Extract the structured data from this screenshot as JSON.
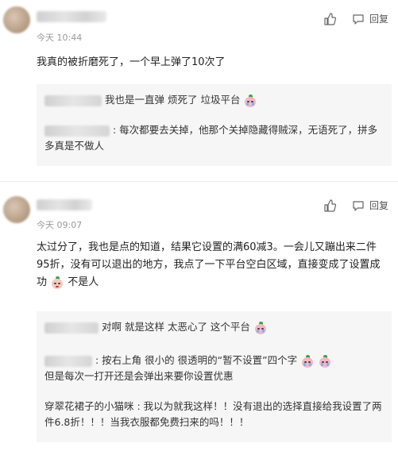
{
  "comments": [
    {
      "time": "今天 10:44",
      "like_label": "",
      "reply_label": "回复",
      "text": "我真的被折磨死了，一个早上弹了10次了",
      "replies": [
        {
          "text": "我也是一直弹 烦死了 垃圾平台"
        },
        {
          "text": ": 每次都要去关掉，他那个关掉隐藏得贼深，无语死了，拼多多真是不做人"
        }
      ]
    },
    {
      "time": "今天 09:07",
      "like_label": "",
      "reply_label": "回复",
      "text_a": "太过分了，我也是点的知道，结果它设置的满60减3。一会儿又蹦出来二件95折，没有可以退出的地方，我点了一下平台空白区域，直接变成了设置成功",
      "text_b": "不是人",
      "replies": [
        {
          "text": "对啊 就是这样 太恶心了 这个平台"
        },
        {
          "text_a": ": 按右上角 很小的 很透明的“暂不设置”四个字",
          "text_b": "但是每次一打开还是会弹出来要你设置优惠"
        },
        {
          "text": "穿翠花裙子的小猫咪 : 我以为就我这样！！没有退出的选择直接给我设置了两件6.8折！！！当我衣服都免费扫来的吗！！！"
        }
      ]
    }
  ],
  "icons": {
    "like": "thumbs-up-icon",
    "reply": "speech-bubble-icon",
    "emoji": "crying-face-emoji",
    "emoji_smile": "smiling-face-emoji"
  },
  "colors": {
    "meta": "#999999",
    "reply_bg": "#f6f6f6"
  }
}
